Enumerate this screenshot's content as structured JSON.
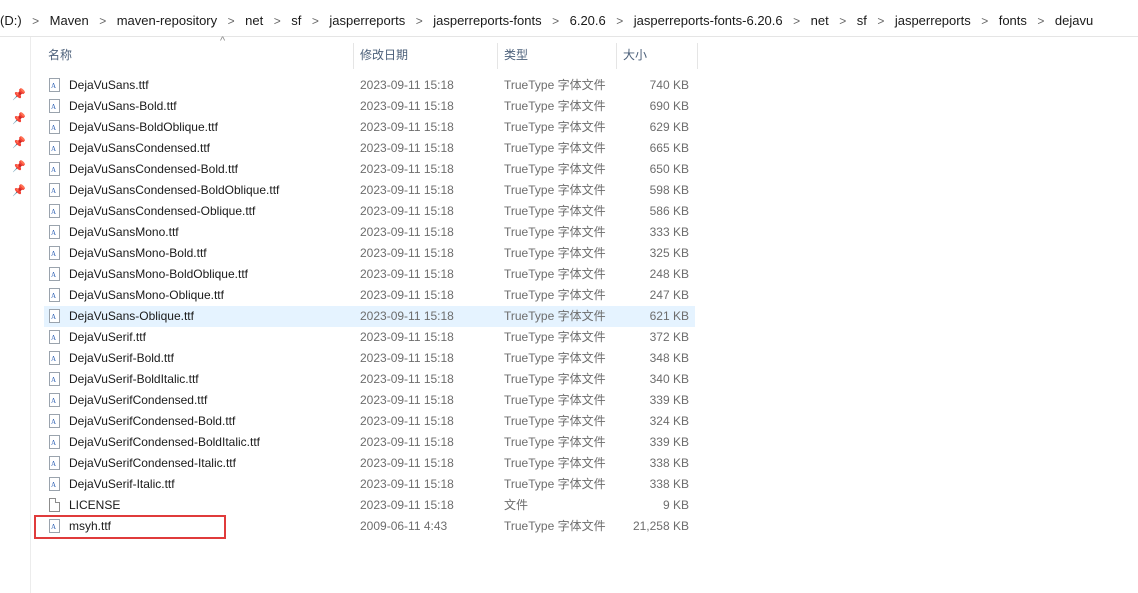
{
  "breadcrumb": [
    "(D:)",
    "Maven",
    "maven-repository",
    "net",
    "sf",
    "jasperreports",
    "jasperreports-fonts",
    "6.20.6",
    "jasperreports-fonts-6.20.6",
    "net",
    "sf",
    "jasperreports",
    "fonts",
    "dejavu"
  ],
  "breadcrumb_separator": ">",
  "breadcrumb_prefix_partial": "‹",
  "columns": {
    "name": "名称",
    "date": "修改日期",
    "type": "类型",
    "size": "大小"
  },
  "sort_indicator": "^",
  "files": [
    {
      "name": "DejaVuSans.ttf",
      "date": "2023-09-11 15:18",
      "type": "TrueType 字体文件",
      "size": "740 KB"
    },
    {
      "name": "DejaVuSans-Bold.ttf",
      "date": "2023-09-11 15:18",
      "type": "TrueType 字体文件",
      "size": "690 KB"
    },
    {
      "name": "DejaVuSans-BoldOblique.ttf",
      "date": "2023-09-11 15:18",
      "type": "TrueType 字体文件",
      "size": "629 KB"
    },
    {
      "name": "DejaVuSansCondensed.ttf",
      "date": "2023-09-11 15:18",
      "type": "TrueType 字体文件",
      "size": "665 KB"
    },
    {
      "name": "DejaVuSansCondensed-Bold.ttf",
      "date": "2023-09-11 15:18",
      "type": "TrueType 字体文件",
      "size": "650 KB"
    },
    {
      "name": "DejaVuSansCondensed-BoldOblique.ttf",
      "date": "2023-09-11 15:18",
      "type": "TrueType 字体文件",
      "size": "598 KB"
    },
    {
      "name": "DejaVuSansCondensed-Oblique.ttf",
      "date": "2023-09-11 15:18",
      "type": "TrueType 字体文件",
      "size": "586 KB"
    },
    {
      "name": "DejaVuSansMono.ttf",
      "date": "2023-09-11 15:18",
      "type": "TrueType 字体文件",
      "size": "333 KB"
    },
    {
      "name": "DejaVuSansMono-Bold.ttf",
      "date": "2023-09-11 15:18",
      "type": "TrueType 字体文件",
      "size": "325 KB"
    },
    {
      "name": "DejaVuSansMono-BoldOblique.ttf",
      "date": "2023-09-11 15:18",
      "type": "TrueType 字体文件",
      "size": "248 KB"
    },
    {
      "name": "DejaVuSansMono-Oblique.ttf",
      "date": "2023-09-11 15:18",
      "type": "TrueType 字体文件",
      "size": "247 KB"
    },
    {
      "name": "DejaVuSans-Oblique.ttf",
      "date": "2023-09-11 15:18",
      "type": "TrueType 字体文件",
      "size": "621 KB",
      "selected": true
    },
    {
      "name": "DejaVuSerif.ttf",
      "date": "2023-09-11 15:18",
      "type": "TrueType 字体文件",
      "size": "372 KB"
    },
    {
      "name": "DejaVuSerif-Bold.ttf",
      "date": "2023-09-11 15:18",
      "type": "TrueType 字体文件",
      "size": "348 KB"
    },
    {
      "name": "DejaVuSerif-BoldItalic.ttf",
      "date": "2023-09-11 15:18",
      "type": "TrueType 字体文件",
      "size": "340 KB"
    },
    {
      "name": "DejaVuSerifCondensed.ttf",
      "date": "2023-09-11 15:18",
      "type": "TrueType 字体文件",
      "size": "339 KB"
    },
    {
      "name": "DejaVuSerifCondensed-Bold.ttf",
      "date": "2023-09-11 15:18",
      "type": "TrueType 字体文件",
      "size": "324 KB"
    },
    {
      "name": "DejaVuSerifCondensed-BoldItalic.ttf",
      "date": "2023-09-11 15:18",
      "type": "TrueType 字体文件",
      "size": "339 KB"
    },
    {
      "name": "DejaVuSerifCondensed-Italic.ttf",
      "date": "2023-09-11 15:18",
      "type": "TrueType 字体文件",
      "size": "338 KB"
    },
    {
      "name": "DejaVuSerif-Italic.ttf",
      "date": "2023-09-11 15:18",
      "type": "TrueType 字体文件",
      "size": "338 KB"
    },
    {
      "name": "LICENSE",
      "date": "2023-09-11 15:18",
      "type": "文件",
      "size": "9 KB",
      "icon": "plain-file-icon"
    },
    {
      "name": "msyh.ttf",
      "date": "2009-06-11 4:43",
      "type": "TrueType 字体文件",
      "size": "21,258 KB",
      "highlighted": true
    }
  ],
  "icons": {
    "font": "font-file-icon",
    "plain": "plain-file-icon",
    "pin": "pin-icon"
  },
  "colors": {
    "selection": "#e5f3ff",
    "highlight_box": "#e03b3b",
    "header_text": "#4c607a"
  }
}
